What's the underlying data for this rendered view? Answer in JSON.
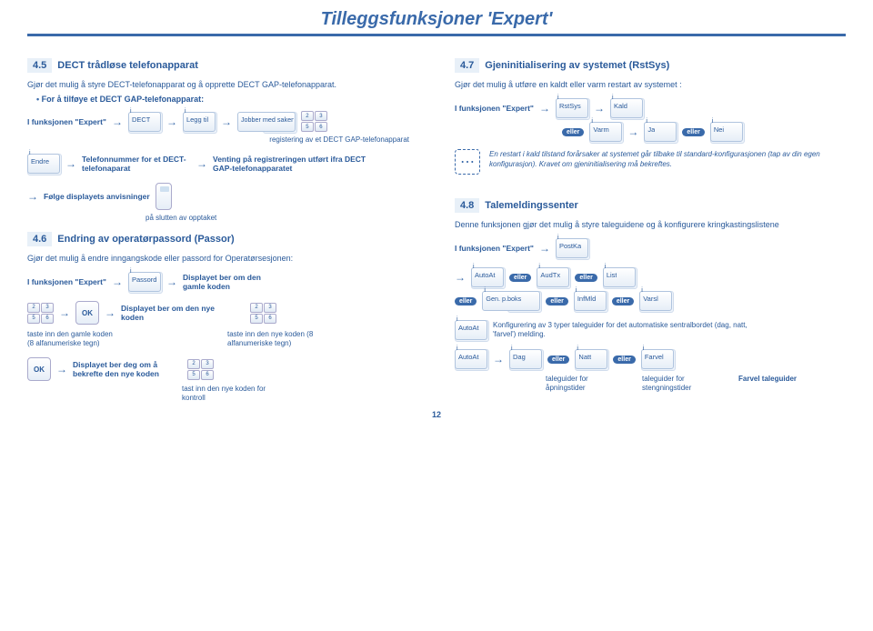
{
  "page": {
    "title": "Tilleggsfunksjoner 'Expert'",
    "number": "12"
  },
  "common": {
    "arrow": "→",
    "eller": "eller",
    "ok": "OK",
    "expert": "I funksjonen \"Expert\"",
    "expert_plural": "I funksjonen \"Expert\""
  },
  "s45": {
    "num": "4.5",
    "title": "DECT trådløse telefonapparat",
    "intro": "Gjør det mulig å styre DECT-telefonapparat og å opprette DECT GAP-telefonapparat.",
    "sub": "For å tilføye et DECT GAP-telefonapparat:",
    "k_dect": "DECT",
    "k_legg": "Legg til",
    "k_jobber": "Jobber med saken",
    "reg": "registering av et DECT GAP-telefonapparat",
    "k_endre": "Endre",
    "telnum": "Telefonnummer for et DECT-telefonaparat",
    "venting": "Venting på registreringen utført ifra DECT GAP-telefonapparatet",
    "folge": "Følge displayets anvisninger",
    "slutten": "på slutten av opptaket"
  },
  "s46": {
    "num": "4.6",
    "title": "Endring av operatørpassord (Passor)",
    "intro": "Gjør det mulig å endre inngangskode eller passord for Operatørsesjonen:",
    "k_passord": "Passord",
    "disp_gamle": "Displayet ber om den gamle koden",
    "taste_gamle": "taste inn den gamle koden (8 alfanumeriske tegn)",
    "disp_nye": "Displayet ber om den nye koden",
    "taste_nye": "taste inn den nye koden (8 alfanumeriske tegn)",
    "disp_bekreft": "Displayet ber deg om å bekrefte den nye koden",
    "tast_kontroll": "tast inn den nye koden for kontroll"
  },
  "s47": {
    "num": "4.7",
    "title": "Gjeninitialisering av systemet (RstSys)",
    "intro": "Gjør det mulig å utføre en kaldt eller varm restart av systemet :",
    "k_rstsys": "RstSys",
    "k_kald": "Kald",
    "k_varm": "Varm",
    "k_ja": "Ja",
    "k_nei": "Nei",
    "warn": "En restart i kald tilstand forårsaker at systemet går tilbake til standard-konfigurasjonen (tap av din egen konfigurasjon). Kravet om gjeninitialisering må bekreftes."
  },
  "s48": {
    "num": "4.8",
    "title": "Talemeldingssenter",
    "intro": "Denne funksjonen gjør det mulig å styre taleguidene og å konfigurere kringkastingslistene",
    "k_postka": "PostKa",
    "k_autoat": "AutoAt",
    "k_audtx": "AudTx",
    "k_list": "List",
    "k_genpboks": "Gen. p.boks",
    "k_infmld": "InfMld",
    "k_varsl": "Varsl",
    "konfig": "Konfigurering av 3 typer taleguider for det automatiske sentralbordet (dag, natt, 'farvel') melding.",
    "k_dag": "Dag",
    "k_natt": "Natt",
    "k_farvel": "Farvel",
    "tg_aap": "taleguider for åpningstider",
    "tg_steng": "taleguider for stengningstider",
    "tg_farvel": "Farvel taleguider"
  }
}
